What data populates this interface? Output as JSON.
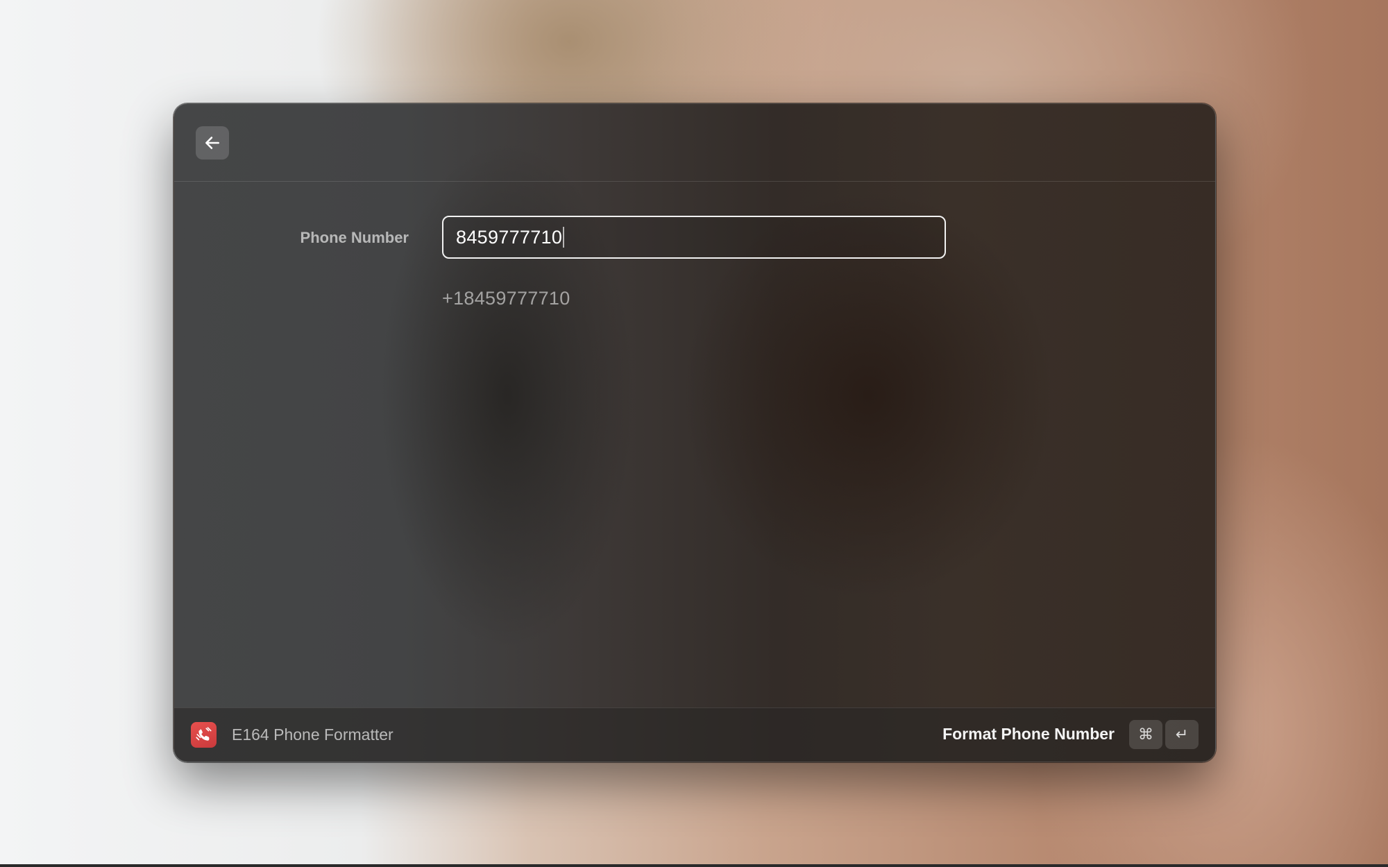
{
  "window": {
    "back_icon": "arrow-left-icon"
  },
  "form": {
    "phone_label": "Phone Number",
    "phone_value": "8459777710",
    "formatted_value": "+18459777710"
  },
  "footer": {
    "app_icon": "phone-formatter-app-icon",
    "app_name": "E164 Phone Formatter",
    "action_label": "Format Phone Number",
    "shortcut_keys": [
      "⌘",
      "↵"
    ]
  },
  "colors": {
    "app_icon_red": "#e0484a",
    "input_border": "#f2f2f2"
  }
}
